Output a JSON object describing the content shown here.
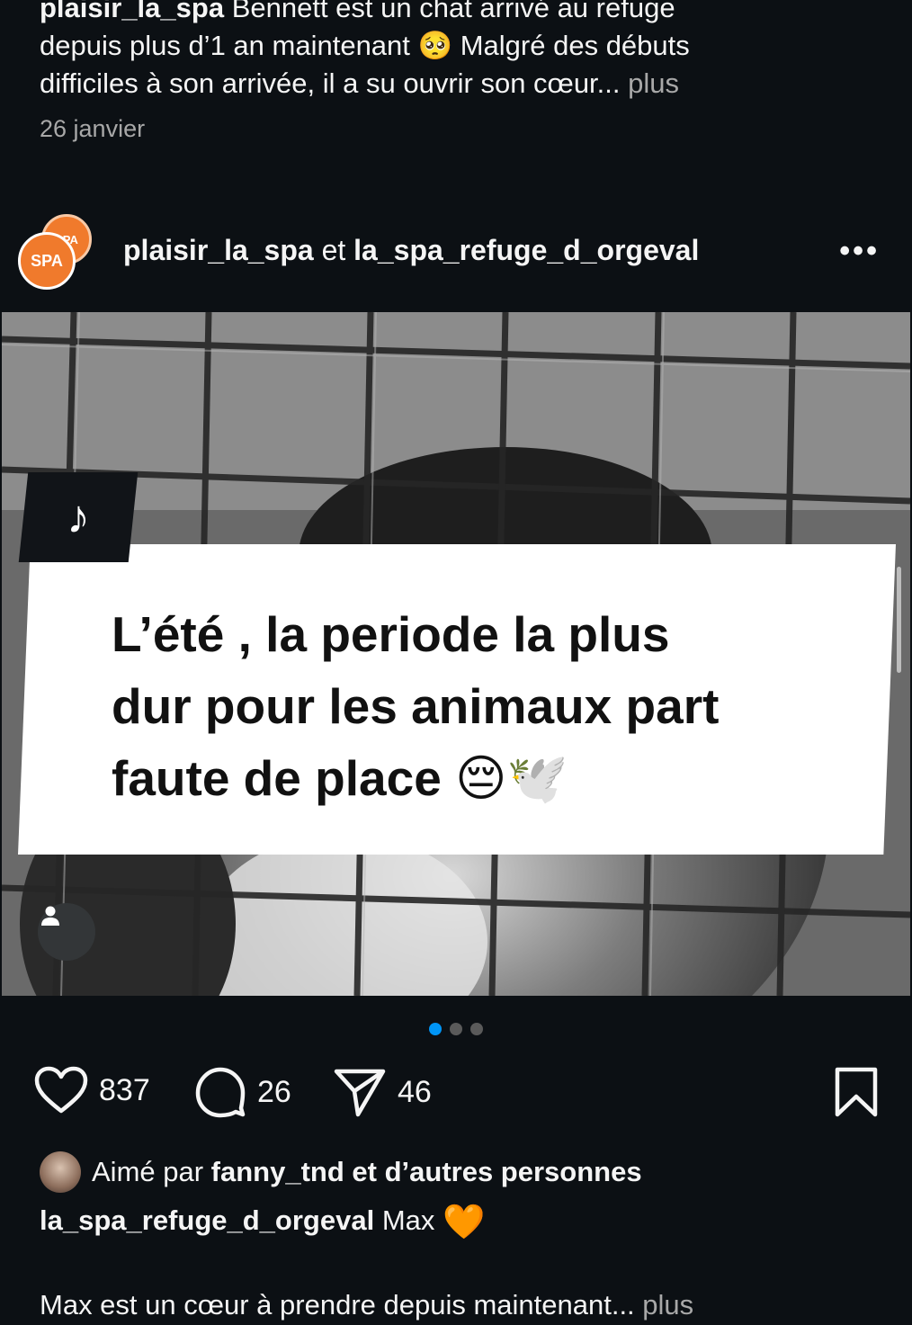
{
  "previous_post": {
    "username": "plaisir_la_spa",
    "caption_line1": " Bennett est un chat arrivé au refuge",
    "caption_line2": "depuis plus d’1 an maintenant 🥺 Malgré des débuts",
    "caption_line3": "difficiles à son arrivée, il a su ouvrir son cœur... ",
    "more_label": "plus",
    "date": "26 janvier"
  },
  "post": {
    "header": {
      "avatar_text": "SPA",
      "user1": "plaisir_la_spa",
      "joiner": "et",
      "user2": "la_spa_refuge_d_orgeval",
      "more_icon": "more-dots-icon"
    },
    "media": {
      "badge_icon": "tiktok-icon",
      "overlay_text_line1": "L’été , la periode la plus",
      "overlay_text_line2": "dur pour les animaux part",
      "overlay_text_line3": "faute de place 😔🕊️",
      "tag_icon": "user-tag-icon",
      "carousel_index": 1,
      "carousel_total": 3
    },
    "actions": {
      "likes": "837",
      "comments": "26",
      "shares": "46"
    },
    "liked_by": {
      "prefix": "Aimé par",
      "user": "fanny_tnd",
      "suffix": "et d’autres personnes"
    },
    "caption": {
      "username": "la_spa_refuge_d_orgeval",
      "text": "Max",
      "emoji": "🧡",
      "line2": "Max est un cœur à prendre depuis maintenant... ",
      "more_label": "plus"
    }
  },
  "colors": {
    "background": "#0c1014",
    "accent": "#0095f6",
    "muted_text": "#a8a8a8",
    "brand_orange": "#f07a2c"
  }
}
